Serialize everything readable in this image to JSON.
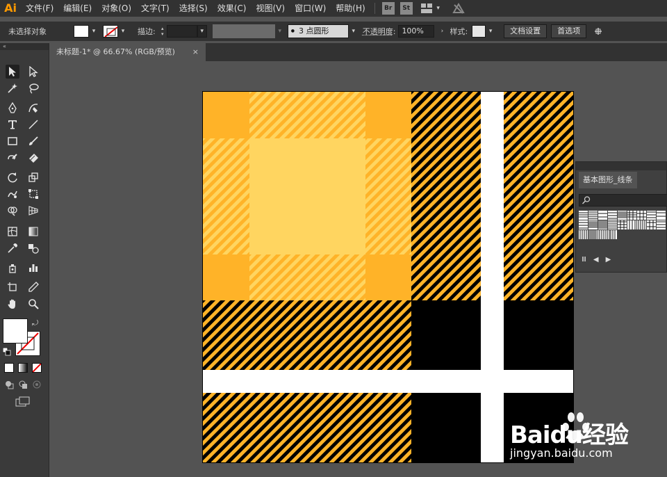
{
  "app": {
    "logo": "Ai"
  },
  "menu": [
    "文件(F)",
    "编辑(E)",
    "对象(O)",
    "文字(T)",
    "选择(S)",
    "效果(C)",
    "视图(V)",
    "窗口(W)",
    "帮助(H)"
  ],
  "app_buttons": [
    "Br",
    "St"
  ],
  "control_bar": {
    "selection_status": "未选择对象",
    "stroke_label": "描边",
    "brush_value": "3 点圆形",
    "opacity_label": "不透明度",
    "opacity_value": "100%",
    "style_label": "样式",
    "doc_setup_button": "文档设置",
    "preferences_button": "首选项"
  },
  "document_tab": {
    "title": "未标题-1* @ 66.67% (RGB/预览)",
    "close": "×"
  },
  "swatches_panel": {
    "tab_label": "基本图形_线条"
  },
  "colors": {
    "accent_logo": "#ff9a00",
    "plaid_orange": "#ffb328",
    "plaid_light": "#ffd560",
    "plaid_black": "#000000",
    "plaid_white": "#ffffff"
  },
  "watermark": {
    "brand": "Baidu经验",
    "url": "jingyan.baidu.com"
  },
  "tools": [
    "selection-tool",
    "direct-selection-tool",
    "magic-wand-tool",
    "lasso-tool",
    "pen-tool",
    "curvature-tool",
    "type-tool",
    "line-tool",
    "rectangle-tool",
    "paintbrush-tool",
    "shaper-tool",
    "eraser-tool",
    "rotate-tool",
    "scale-tool",
    "warp-tool",
    "free-transform-tool",
    "shape-builder-tool",
    "perspective-grid-tool",
    "mesh-tool",
    "gradient-tool",
    "eyedropper-tool",
    "blend-tool",
    "symbol-sprayer-tool",
    "column-graph-tool",
    "artboard-tool",
    "slice-tool",
    "hand-tool",
    "zoom-tool"
  ]
}
